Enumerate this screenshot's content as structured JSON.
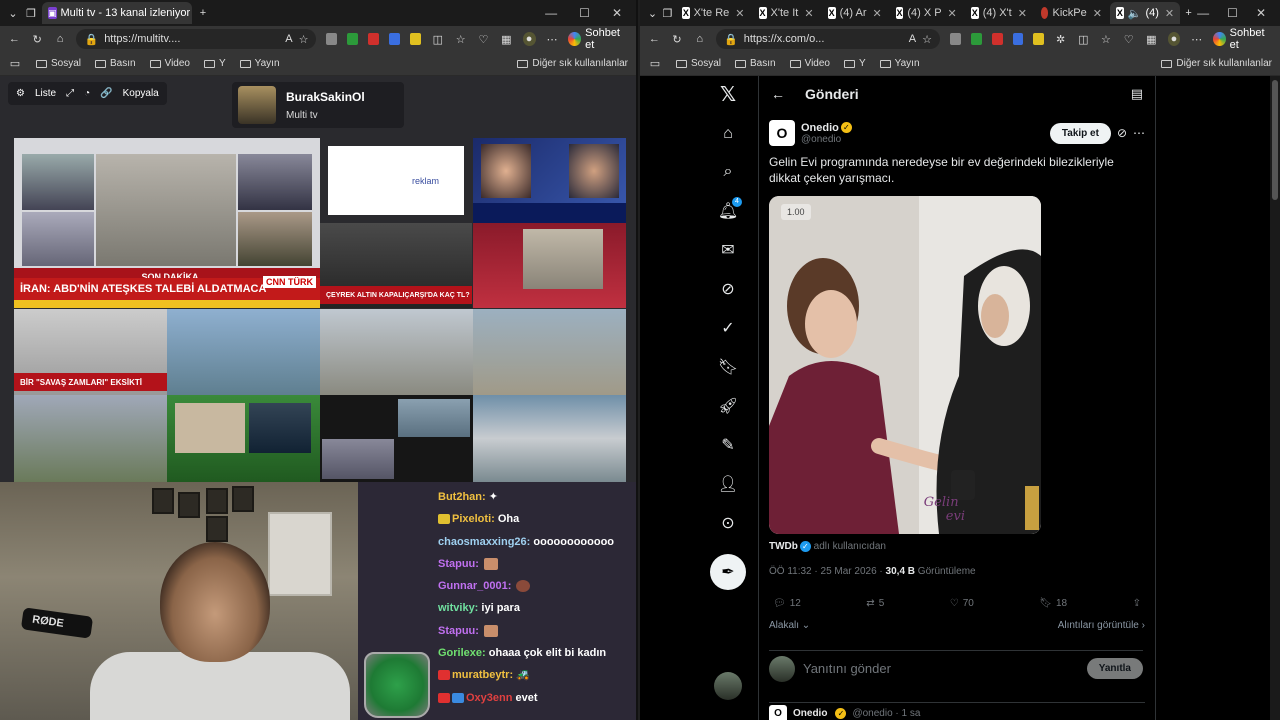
{
  "left_window": {
    "tabs": [
      {
        "title": "Multi tv - 13 kanal izleniyor",
        "active": true
      }
    ],
    "url": "https://multitv....",
    "chat_button": "Sohbet et",
    "bookmarks": [
      "Sosyal",
      "Basın",
      "Video",
      "Y",
      "Yayın"
    ],
    "other_bookmarks": "Diğer sık kullanılanlar"
  },
  "multitv": {
    "list_label": "Liste",
    "copy_label": "Kopyala",
    "channel_name": "BurakSakinOl",
    "channel_sub": "Multi tv",
    "cells": [
      {
        "label": "SON DAKİKA",
        "strip": "İRAN: ABD'NİN ATEŞKES TALEBİ ALDATMACA",
        "brand": "CNN TÜRK"
      },
      {
        "label": "reklam"
      },
      {
        "strip": "ÇEYREK ALTIN KAPALIÇARŞI'DA KAÇ TL?"
      },
      {
        "strip": "BİR \"SAVAŞ ZAMLARI\" EKSİKTİ"
      }
    ]
  },
  "chat": {
    "messages": [
      {
        "user": "But2han:",
        "text": "",
        "color": "#f0c040"
      },
      {
        "user": "Pixeloti:",
        "text": "Oha",
        "color": "#f0c040"
      },
      {
        "user": "chaosmaxxing26:",
        "text": "oooooooooooo",
        "color": "#9fd0f0"
      },
      {
        "user": "Stapuu:",
        "text": "",
        "color": "#c070f0"
      },
      {
        "user": "Gunnar_0001:",
        "text": "",
        "color": "#c070f0"
      },
      {
        "user": "witviky:",
        "text": "iyi para",
        "color": "#70e0a0"
      },
      {
        "user": "Stapuu:",
        "text": "",
        "color": "#c070f0"
      },
      {
        "user": "Gorilexe:",
        "text": "ohaaa çok elit bi kadın",
        "color": "#70e070"
      },
      {
        "user": "muratbeytr:",
        "text": "",
        "color": "#f0c040"
      },
      {
        "user": "Oxy3enn",
        "text": "evet",
        "color": "#e04040"
      }
    ]
  },
  "right_window": {
    "tabs": [
      "X'te Re",
      "X'te It",
      "(4) Ar",
      "(4) X P",
      "(4) X't",
      "KickPe",
      "(4)"
    ],
    "url": "https://x.com/o...",
    "chat_button": "Sohbet et",
    "bookmarks": [
      "Sosyal",
      "Basın",
      "Video",
      "Y",
      "Yayın"
    ],
    "other_bookmarks": "Diğer sık kullanılanlar"
  },
  "x": {
    "header_title": "Gönderi",
    "notif_count": "4",
    "author_name": "Onedio",
    "author_handle": "@onedio",
    "follow_label": "Takip et",
    "tweet_text": "Gelin Evi programında neredeyse bir ev değerindeki bilezikleriyle dikkat çeken yarışmacı.",
    "video_speed": "1.00",
    "watermark_1": "Gelin",
    "watermark_2": "evi",
    "via_user": "TWDb",
    "via_text": "adlı kullanıcıdan",
    "time": "ÖÖ 11:32 · 25 Mar 2026 ·",
    "views_count": "30,4 B",
    "views_label": "Görüntüleme",
    "replies": "12",
    "reposts": "5",
    "likes": "70",
    "bookmarks": "18",
    "sort_label": "Alakalı",
    "quotes_label": "Alıntıları görüntüle",
    "reply_placeholder": "Yanıtını gönder",
    "reply_button": "Yanıtla",
    "next_post_name": "Onedio",
    "next_post_handle": "@onedio · 1 sa"
  }
}
